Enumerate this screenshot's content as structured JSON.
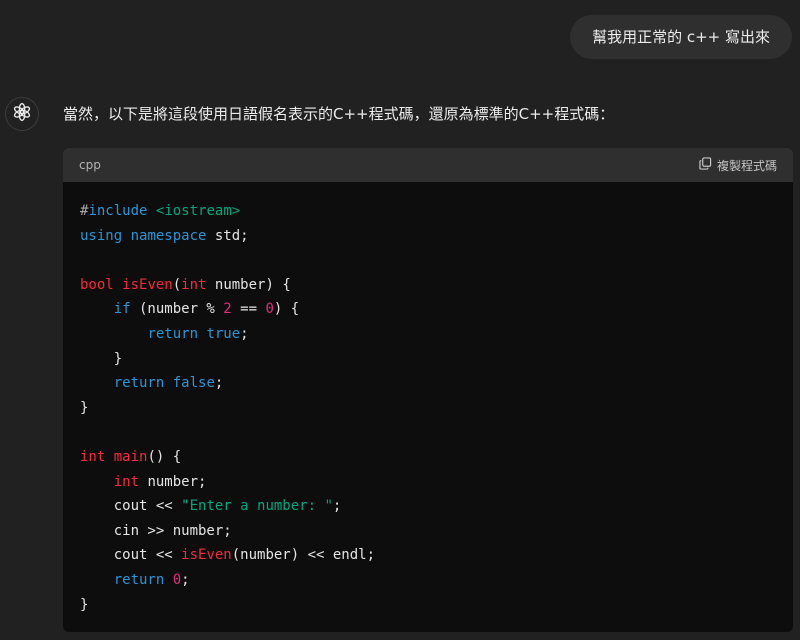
{
  "user_message": "幫我用正常的 c++ 寫出來",
  "assistant_message": "當然，以下是將這段使用日語假名表示的C++程式碼，還原為標準的C++程式碼：",
  "code_block": {
    "language": "cpp",
    "copy_label": "複製程式碼",
    "lines": [
      [
        {
          "t": "#",
          "c": "hash"
        },
        {
          "t": "include",
          "c": "preproc"
        },
        {
          "t": " "
        },
        {
          "t": "<iostream>",
          "c": "str-green"
        }
      ],
      [
        {
          "t": "using",
          "c": "kw-blue"
        },
        {
          "t": " "
        },
        {
          "t": "namespace",
          "c": "kw-blue"
        },
        {
          "t": " std;"
        }
      ],
      [],
      [
        {
          "t": "bool",
          "c": "kw-red"
        },
        {
          "t": " "
        },
        {
          "t": "isEven",
          "c": "kw-red"
        },
        {
          "t": "("
        },
        {
          "t": "int",
          "c": "kw-red"
        },
        {
          "t": " number) {"
        }
      ],
      [
        {
          "t": "    "
        },
        {
          "t": "if",
          "c": "kw-blue"
        },
        {
          "t": " (number % "
        },
        {
          "t": "2",
          "c": "num"
        },
        {
          "t": " == "
        },
        {
          "t": "0",
          "c": "num"
        },
        {
          "t": ") {"
        }
      ],
      [
        {
          "t": "        "
        },
        {
          "t": "return",
          "c": "kw-blue"
        },
        {
          "t": " "
        },
        {
          "t": "true",
          "c": "kw-blue"
        },
        {
          "t": ";"
        }
      ],
      [
        {
          "t": "    }"
        }
      ],
      [
        {
          "t": "    "
        },
        {
          "t": "return",
          "c": "kw-blue"
        },
        {
          "t": " "
        },
        {
          "t": "false",
          "c": "kw-blue"
        },
        {
          "t": ";"
        }
      ],
      [
        {
          "t": "}"
        }
      ],
      [],
      [
        {
          "t": "int",
          "c": "kw-red"
        },
        {
          "t": " "
        },
        {
          "t": "main",
          "c": "kw-red"
        },
        {
          "t": "() {"
        }
      ],
      [
        {
          "t": "    "
        },
        {
          "t": "int",
          "c": "kw-red"
        },
        {
          "t": " number;"
        }
      ],
      [
        {
          "t": "    cout << "
        },
        {
          "t": "\"Enter a number: \"",
          "c": "str-green"
        },
        {
          "t": ";"
        }
      ],
      [
        {
          "t": "    cin >> number;"
        }
      ],
      [
        {
          "t": "    cout << "
        },
        {
          "t": "isEven",
          "c": "kw-red"
        },
        {
          "t": "(number) << endl;"
        }
      ],
      [
        {
          "t": "    "
        },
        {
          "t": "return",
          "c": "kw-blue"
        },
        {
          "t": " "
        },
        {
          "t": "0",
          "c": "num"
        },
        {
          "t": ";"
        }
      ],
      [
        {
          "t": "}"
        }
      ]
    ]
  },
  "icons": {
    "assistant_avatar": "openai-logo-icon",
    "copy": "copy-icon"
  },
  "colors": {
    "background": "#212121",
    "user_bubble": "#2f2f2f",
    "code_bg": "#0d0d0d",
    "code_header": "#2f2f2f",
    "keyword_blue": "#2e95d3",
    "keyword_red": "#f22c3d",
    "string_green": "#00a67d",
    "number_pink": "#df3079"
  }
}
